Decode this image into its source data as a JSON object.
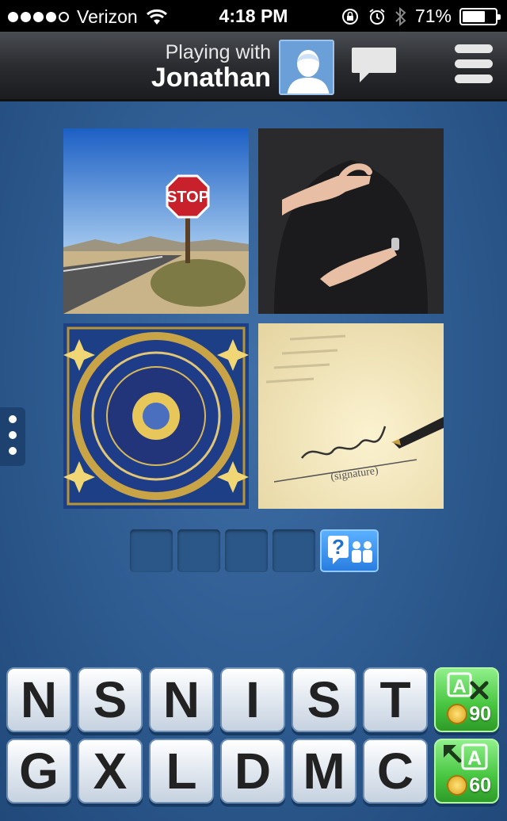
{
  "status_bar": {
    "carrier": "Verizon",
    "time": "4:18 PM",
    "battery": "71%",
    "battery_level": 0.71
  },
  "header": {
    "playing_with_label": "Playing with",
    "opponent_name": "Jonathan",
    "chat_icon": "chat-bubble-icon",
    "menu_icon": "hamburger-menu-icon"
  },
  "puzzle": {
    "photos": [
      {
        "subject": "stop-sign",
        "sign_text": "STOP"
      },
      {
        "subject": "hand-gesture"
      },
      {
        "subject": "zodiac-clock"
      },
      {
        "subject": "signature",
        "caption": "(signature)"
      }
    ],
    "answer_slots": 4,
    "hint_icon": "question-people-icon"
  },
  "keyboard": {
    "row1": [
      "N",
      "S",
      "N",
      "I",
      "S",
      "T"
    ],
    "row2": [
      "G",
      "X",
      "L",
      "D",
      "M",
      "C"
    ],
    "remove_letters": {
      "icon": "remove-letter-icon",
      "cost": "90"
    },
    "reveal_letter": {
      "icon": "reveal-letter-icon",
      "cost": "60"
    }
  },
  "colors": {
    "background": "#2d5a8f",
    "key_face": "#e4eaf1",
    "powerup_green": "#46c43f",
    "hint_blue": "#2a7de0"
  }
}
